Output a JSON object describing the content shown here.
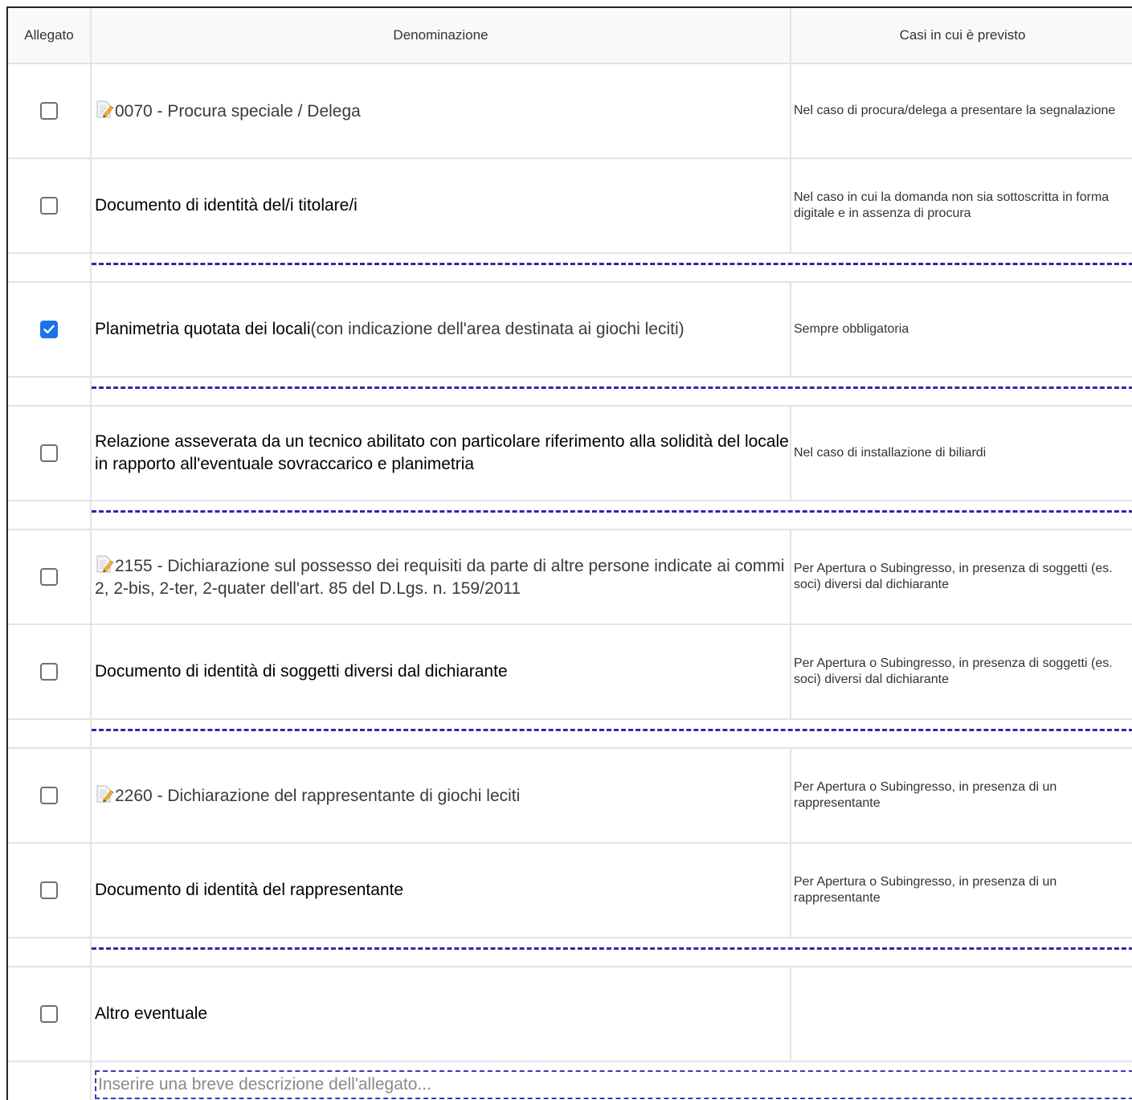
{
  "table": {
    "headers": {
      "allegato": "Allegato",
      "denominazione": "Denominazione",
      "casi": "Casi in cui è previsto"
    },
    "rows": [
      {
        "checked": false,
        "icon": "document-edit-icon",
        "code": "0070 - Procura speciale / Delega",
        "name": "",
        "note": "",
        "case": "Nel caso di procura/delega a presentare la segnalazione"
      },
      {
        "checked": false,
        "icon": "",
        "code": "",
        "name": "Documento di identità del/i titolare/i",
        "note": "",
        "case": "Nel caso in cui la domanda non sia sottoscritta in forma digitale e in assenza di procura"
      },
      {
        "checked": true,
        "icon": "",
        "code": "",
        "name": "Planimetria quotata dei locali",
        "note": "(con indicazione dell'area destinata ai giochi leciti)",
        "case": "Sempre obbligatoria"
      },
      {
        "checked": false,
        "icon": "",
        "code": "",
        "name": "Relazione asseverata da un tecnico abilitato con particolare riferimento alla solidità del locale in rapporto all'eventuale sovraccarico e planimetria",
        "note": "",
        "case": "Nel caso di installazione di biliardi"
      },
      {
        "checked": false,
        "icon": "document-edit-icon",
        "code": "2155 - Dichiarazione sul possesso dei requisiti da parte di altre persone indicate ai commi 2, 2-bis, 2-ter, 2-quater dell'art. 85 del D.Lgs. n. 159/2011",
        "name": "",
        "note": "",
        "case": "Per Apertura o Subingresso, in presenza di soggetti (es. soci) diversi dal dichiarante"
      },
      {
        "checked": false,
        "icon": "",
        "code": "",
        "name": "Documento di identità di soggetti diversi dal dichiarante",
        "note": "",
        "case": "Per Apertura o Subingresso, in presenza di soggetti (es. soci) diversi dal dichiarante"
      },
      {
        "checked": false,
        "icon": "document-edit-icon",
        "code": "2260 - Dichiarazione del rappresentante di giochi leciti",
        "name": "",
        "note": "",
        "case": "Per Apertura o Subingresso, in presenza di un rappresentante"
      },
      {
        "checked": false,
        "icon": "",
        "code": "",
        "name": "Documento di identità del rappresentante",
        "note": "",
        "case": "Per Apertura o Subingresso, in presenza di un rappresentante"
      },
      {
        "checked": false,
        "icon": "",
        "code": "",
        "name": "Altro eventuale",
        "note": "",
        "case": ""
      }
    ],
    "description_input": {
      "value": "",
      "placeholder": "Inserire una breve descrizione dell'allegato..."
    }
  },
  "colors": {
    "checkbox_checked": "#1a73e8",
    "separator_dash": "#2a2aa8",
    "header_bg": "#f9f9f9"
  }
}
